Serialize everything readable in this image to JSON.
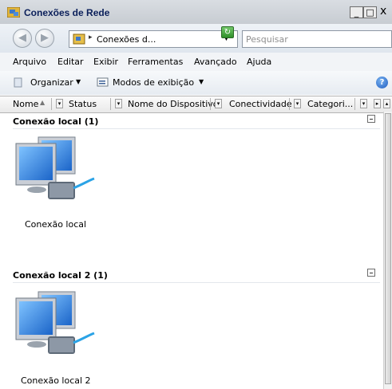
{
  "window": {
    "title": "Conexões de Rede",
    "controls": {
      "minimize": "_",
      "maximize": "□",
      "close": "x"
    }
  },
  "nav": {
    "address_text": "Conexões d...",
    "address_separator": "▸",
    "search_placeholder": "Pesquisar"
  },
  "menu": [
    "Arquivo",
    "Editar",
    "Exibir",
    "Ferramentas",
    "Avançado",
    "Ajuda"
  ],
  "toolbar": {
    "organize": "Organizar",
    "views": "Modos de exibição",
    "help": "?"
  },
  "columns": [
    "Nome",
    "Status",
    "Nome do Dispositivo",
    "Conectividade",
    "Categori..."
  ],
  "groups": [
    {
      "title": "Conexão local (1)",
      "item": "Conexão local"
    },
    {
      "title": "Conexão local 2 (1)",
      "item": "Conexão local 2"
    }
  ],
  "colors": {
    "title_text": "#0a1f5a",
    "address_border": "#8d97a3",
    "search_placeholder": "#8f8f8f"
  },
  "icons": [
    "network-folder-icon",
    "back-arrow-icon",
    "forward-arrow-icon",
    "refresh-icon",
    "organize-icon",
    "views-icon",
    "help-icon",
    "network-adapter-icon"
  ]
}
